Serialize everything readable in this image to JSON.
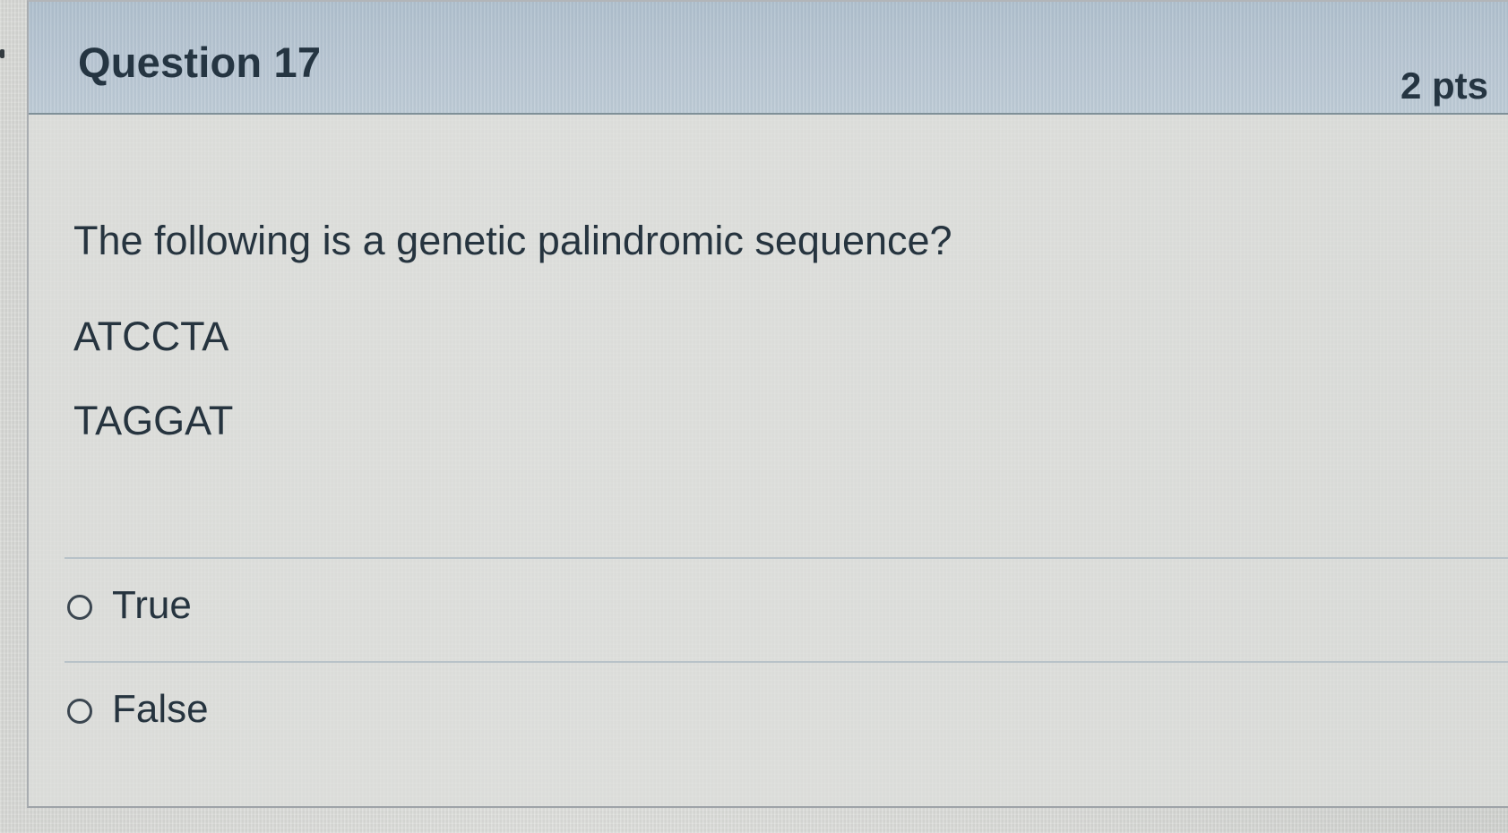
{
  "question": {
    "title": "Question 17",
    "points": "2 pts",
    "prompt": "The following is a genetic palindromic sequence?",
    "sequences": [
      "ATCCTA",
      "TAGGAT"
    ]
  },
  "answers": [
    {
      "label": "True",
      "selected": false
    },
    {
      "label": "False",
      "selected": false
    }
  ],
  "icons": {
    "radio": "radio-button-icon"
  },
  "colors": {
    "header_background": "#b7c5d2",
    "text": "#253542",
    "page_background": "#d8d9d6"
  }
}
